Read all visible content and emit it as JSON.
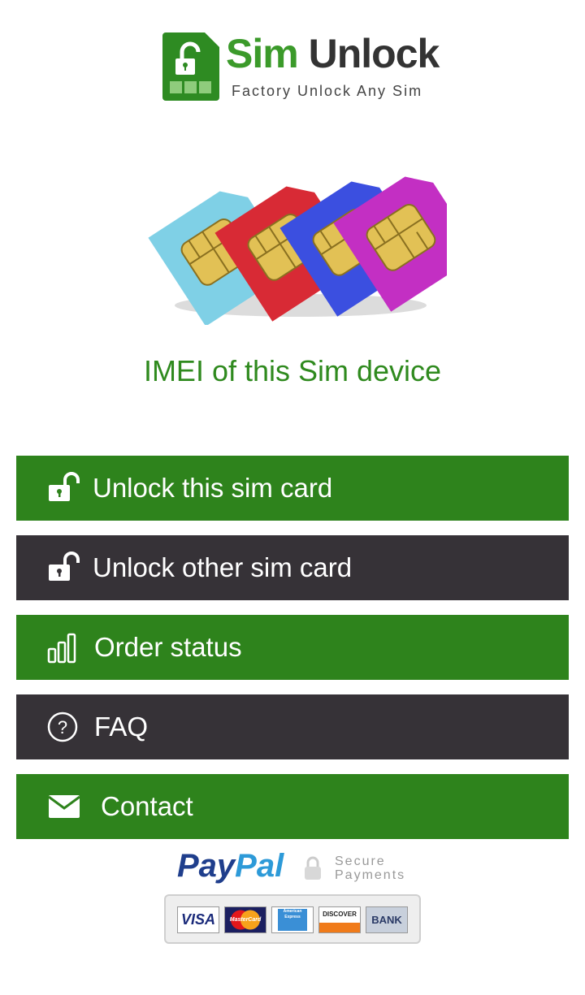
{
  "logo": {
    "title_part1": "Sim",
    "title_part2": "Unlock",
    "tagline": "Factory Unlock Any Sim"
  },
  "imei_label": "IMEI of this Sim device",
  "menu": [
    {
      "label": "Unlock this sim card",
      "icon": "unlocked-padlock-icon",
      "color": "#2e831c"
    },
    {
      "label": "Unlock other sim card",
      "icon": "unlocked-padlock-icon",
      "color": "#363237"
    },
    {
      "label": "Order status",
      "icon": "signal-bars-icon",
      "color": "#2e831c"
    },
    {
      "label": "FAQ",
      "icon": "question-circle-icon",
      "color": "#363237"
    },
    {
      "label": "Contact",
      "icon": "envelope-icon",
      "color": "#2e831c"
    }
  ],
  "payment": {
    "brand_part1": "Pay",
    "brand_part2": "Pal",
    "secure_line1": "Secure",
    "secure_line2": "Payments",
    "cards": [
      "VISA",
      "MasterCard",
      "American Express",
      "DISCOVER",
      "BANK"
    ]
  }
}
